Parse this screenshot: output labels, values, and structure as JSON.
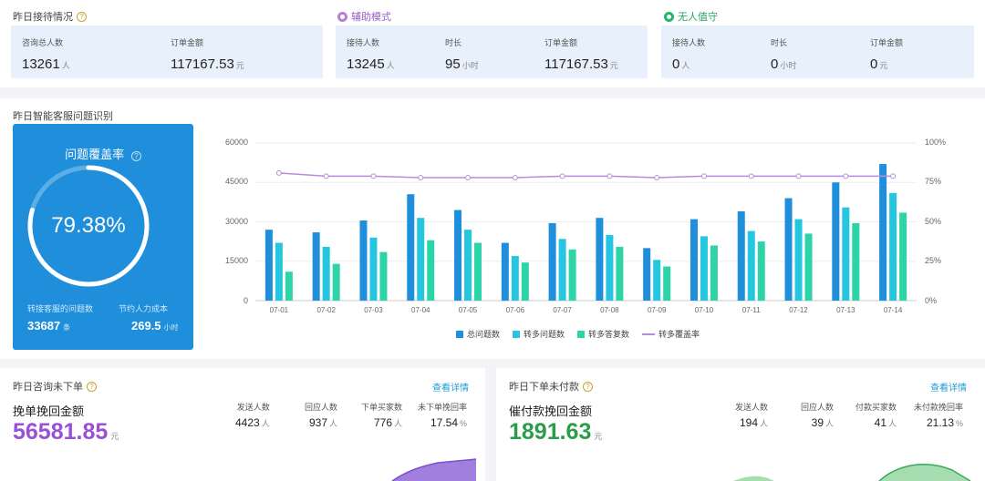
{
  "top": {
    "title": "昨日接待情况",
    "help_icon": "question-icon",
    "left_stats": [
      {
        "label": "咨询总人数",
        "value": "13261",
        "unit": "人"
      },
      {
        "label": "订单金额",
        "value": "117167.53",
        "unit": "元"
      }
    ],
    "assist": {
      "title": "辅助模式",
      "color": "#b77fd8",
      "stats": [
        {
          "label": "接待人数",
          "value": "13245",
          "unit": "人"
        },
        {
          "label": "时长",
          "value": "95",
          "unit": "小时"
        },
        {
          "label": "订单金额",
          "value": "117167.53",
          "unit": "元"
        }
      ]
    },
    "unmanned": {
      "title": "无人值守",
      "color": "#27b56a",
      "stats": [
        {
          "label": "接待人数",
          "value": "0",
          "unit": "人"
        },
        {
          "label": "时长",
          "value": "0",
          "unit": "小时"
        },
        {
          "label": "订单金额",
          "value": "0",
          "unit": "元"
        }
      ]
    }
  },
  "middle": {
    "title": "昨日智能客服问题识别",
    "coverage_card": {
      "title": "问题覆盖率",
      "percent": "79.38%",
      "percent_value": 0.7938,
      "left_label": "转接客服的问题数",
      "left_value": "33687",
      "left_unit": "条",
      "right_label": "节约人力成本",
      "right_value": "269.5",
      "right_unit": "小时"
    }
  },
  "chart_data": {
    "type": "bar",
    "categories": [
      "07-01",
      "07-02",
      "07-03",
      "07-04",
      "07-05",
      "07-06",
      "07-07",
      "07-08",
      "07-09",
      "07-10",
      "07-11",
      "07-12",
      "07-13",
      "07-14"
    ],
    "series": [
      {
        "name": "总问题数",
        "color": "#1f8fdc",
        "values": [
          27000,
          26000,
          30500,
          40500,
          34500,
          22000,
          29500,
          31500,
          20000,
          31000,
          34000,
          39000,
          45000,
          52000
        ]
      },
      {
        "name": "转多问题数",
        "color": "#26c6e0",
        "values": [
          22000,
          20500,
          24000,
          31500,
          27000,
          17000,
          23500,
          25000,
          15500,
          24500,
          26500,
          31000,
          35500,
          41000
        ]
      },
      {
        "name": "转多答复数",
        "color": "#2dd4a8",
        "values": [
          11000,
          14000,
          18500,
          23000,
          22000,
          14500,
          19500,
          20500,
          13000,
          21000,
          22500,
          25500,
          29500,
          33500
        ]
      },
      {
        "name": "转多覆盖率",
        "type": "line",
        "color": "#b98ae0",
        "values": [
          0.81,
          0.79,
          0.79,
          0.78,
          0.78,
          0.78,
          0.79,
          0.79,
          0.78,
          0.79,
          0.79,
          0.79,
          0.79,
          0.79
        ]
      }
    ],
    "y_left": {
      "min": 0,
      "max": 60000,
      "ticks": [
        "0",
        "15000",
        "30000",
        "45000",
        "60000"
      ]
    },
    "y_right": {
      "min": 0,
      "max": 1,
      "ticks": [
        "0%",
        "25%",
        "50%",
        "75%",
        "100%"
      ]
    }
  },
  "bottom_left": {
    "title": "昨日咨询未下单",
    "link": "查看详情",
    "big_label": "挽单挽回金额",
    "big_value": "56581.85",
    "big_unit": "元",
    "big_color": "#9b4fd4",
    "stats": [
      {
        "label": "发送人数",
        "value": "4423",
        "unit": "人"
      },
      {
        "label": "回应人数",
        "value": "937",
        "unit": "人"
      },
      {
        "label": "下单买家数",
        "value": "776",
        "unit": "人"
      },
      {
        "label": "未下单挽回率",
        "value": "17.54",
        "unit": "%"
      }
    ]
  },
  "bottom_right": {
    "title": "昨日下单未付款",
    "link": "查看详情",
    "big_label": "催付款挽回金额",
    "big_value": "1891.63",
    "big_unit": "元",
    "big_color": "#2a9d4b",
    "stats": [
      {
        "label": "发送人数",
        "value": "194",
        "unit": "人"
      },
      {
        "label": "回应人数",
        "value": "39",
        "unit": "人"
      },
      {
        "label": "付款买家数",
        "value": "41",
        "unit": "人"
      },
      {
        "label": "未付款挽回率",
        "value": "21.13",
        "unit": "%"
      }
    ]
  }
}
